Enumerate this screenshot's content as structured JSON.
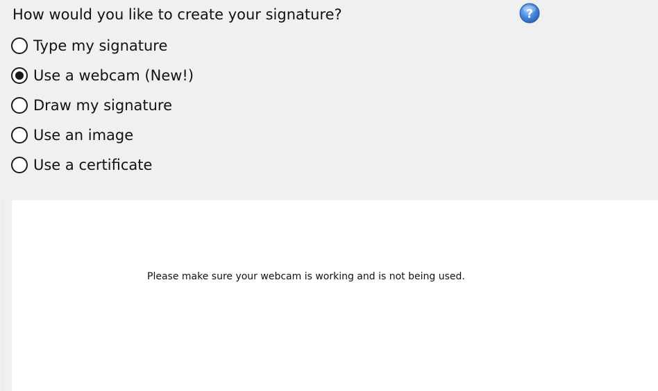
{
  "prompt": {
    "question": "How would you like to create your signature?"
  },
  "help": {
    "icon": "help-question-icon",
    "color": "#3a7fd5"
  },
  "options": [
    {
      "label": "Type my signature",
      "checked": false
    },
    {
      "label": "Use a webcam (New!)",
      "checked": true
    },
    {
      "label": "Draw my signature",
      "checked": false
    },
    {
      "label": "Use an image",
      "checked": false
    },
    {
      "label": "Use a certificate",
      "checked": false
    }
  ],
  "webcam": {
    "message": "Please make sure your webcam is working and is not being used."
  }
}
